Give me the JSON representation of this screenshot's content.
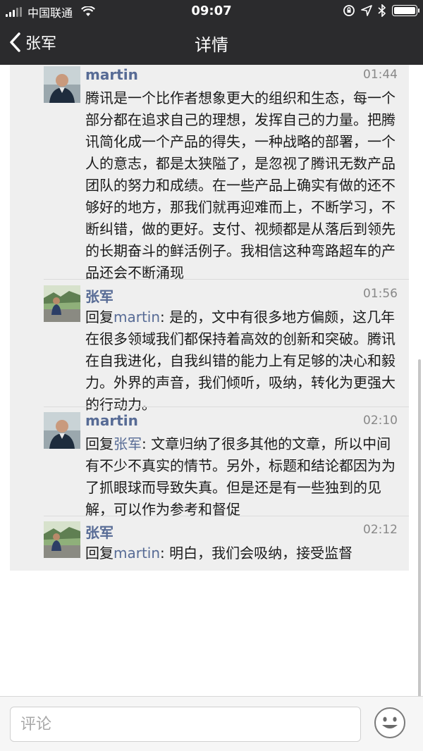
{
  "status_bar": {
    "carrier": "中国联通",
    "time": "09:07"
  },
  "nav": {
    "back_label": "张军",
    "title": "详情"
  },
  "comments": [
    {
      "author": "martin",
      "time": "01:44",
      "reply_prefix": "",
      "reply_to": "",
      "text": "腾讯是一个比作者想象更大的组织和生态，每一个部分都在追求自己的理想，发挥自己的力量。把腾讯简化成一个产品的得失，一种战略的部署，一个人的意志，都是太狭隘了，是忽视了腾讯无数产品团队的努力和成绩。在一些产品上确实有做的还不够好的地方，那我们就再迎难而上，不断学习，不断纠错，做的更好。支付、视频都是从落后到领先的长期奋斗的鲜活例子。我相信这种弯路超车的产品还会不断涌现"
    },
    {
      "author": "张军",
      "time": "01:56",
      "reply_prefix": "回复",
      "reply_to": "martin",
      "text": ": 是的，文中有很多地方偏颇，这几年在很多领域我们都保持着高效的创新和突破。腾讯在自我进化，自我纠错的能力上有足够的决心和毅力。外界的声音，我们倾听，吸纳，转化为更强大的行动力。"
    },
    {
      "author": "martin",
      "time": "02:10",
      "reply_prefix": "回复",
      "reply_to": "张军",
      "text": ": 文章归纳了很多其他的文章，所以中间有不少不真实的情节。另外，标题和结论都因为为了抓眼球而导致失真。但是还是有一些独到的见解，可以作为参考和督促"
    },
    {
      "author": "张军",
      "time": "02:12",
      "reply_prefix": "回复",
      "reply_to": "martin",
      "text": ": 明白，我们会吸纳，接受监督"
    }
  ],
  "input": {
    "placeholder": "评论"
  },
  "colors": {
    "nav_bg": "#2b2b2d",
    "link": "#576b95",
    "content_bg": "#efefef"
  }
}
